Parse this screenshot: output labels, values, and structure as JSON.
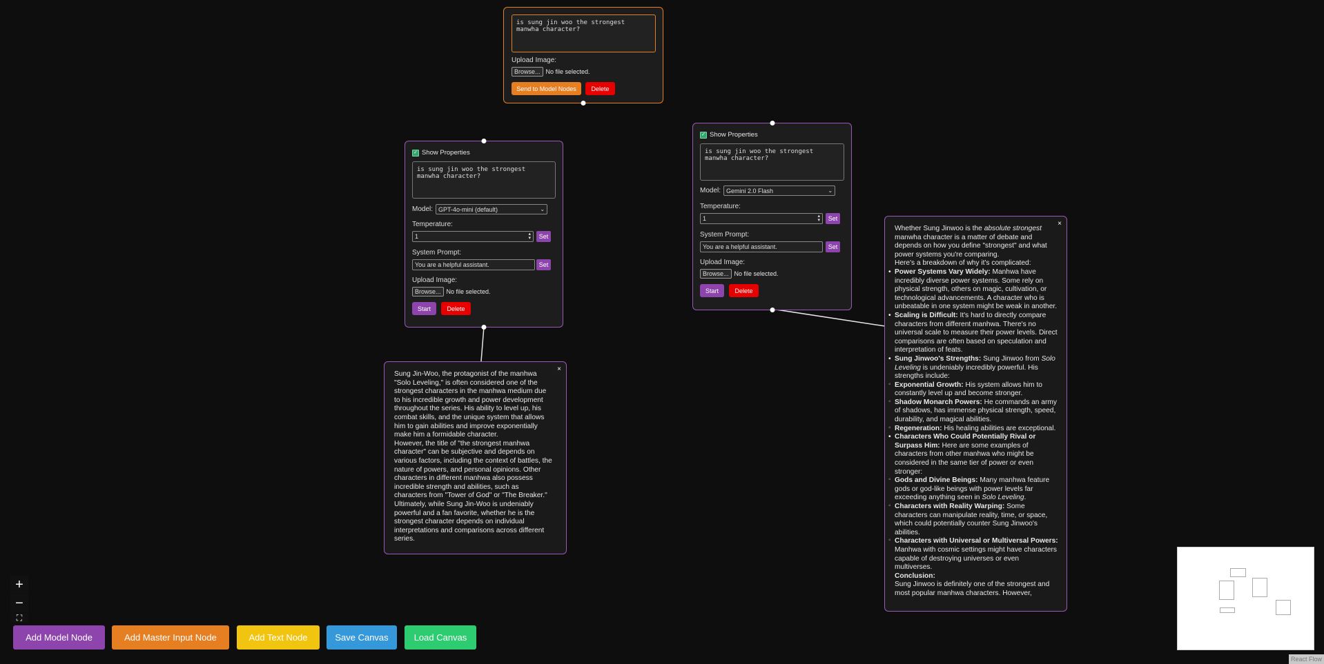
{
  "master_node": {
    "prompt": "is sung jin woo the strongest manwha character?",
    "upload_label": "Upload Image:",
    "browse_label": "Browse...",
    "file_status": "No file selected.",
    "send_label": "Send to Model Nodes",
    "delete_label": "Delete"
  },
  "model_nodes": [
    {
      "show_properties_label": "Show Properties",
      "show_properties_checked": true,
      "prompt": "is sung jin woo the strongest manwha character?",
      "model_label": "Model:",
      "model_value": "GPT-4o-mini (default)",
      "temperature_label": "Temperature:",
      "temperature_value": "1",
      "set_label": "Set",
      "system_prompt_label": "System Prompt:",
      "system_prompt_value": "You are a helpful assistant.",
      "upload_label": "Upload Image:",
      "browse_label": "Browse...",
      "file_status": "No file selected.",
      "start_label": "Start",
      "delete_label": "Delete"
    },
    {
      "show_properties_label": "Show Properties",
      "show_properties_checked": true,
      "prompt": "is sung jin woo the strongest manwha character?",
      "model_label": "Model:",
      "model_value": "Gemini 2.0 Flash",
      "temperature_label": "Temperature:",
      "temperature_value": "1",
      "set_label": "Set",
      "system_prompt_label": "System Prompt:",
      "system_prompt_value": "You are a helpful assistant.",
      "upload_label": "Upload Image:",
      "browse_label": "Browse...",
      "file_status": "No file selected.",
      "start_label": "Start",
      "delete_label": "Delete"
    }
  ],
  "output_gpt": {
    "close": "×",
    "p1": "Sung Jin-Woo, the protagonist of the manhwa \"Solo Leveling,\" is often considered one of the strongest characters in the manhwa medium due to his incredible growth and power development throughout the series. His ability to level up, his combat skills, and the unique system that allows him to gain abilities and improve exponentially make him a formidable character.",
    "p2": "However, the title of \"the strongest manhwa character\" can be subjective and depends on various factors, including the context of battles, the nature of powers, and personal opinions. Other characters in different manhwa also possess incredible strength and abilities, such as characters from \"Tower of God\" or \"The Breaker.\" Ultimately, while Sung Jin-Woo is undeniably powerful and a fan favorite, whether he is the strongest character depends on individual interpretations and comparisons across different series."
  },
  "output_gemini": {
    "close": "×",
    "intro_a": "Whether Sung Jinwoo is the ",
    "intro_em": "absolute strongest",
    "intro_b": " manwha character is a matter of debate and depends on how you define \"strongest\" and what power systems you're comparing.",
    "breakdown": "Here's a breakdown of why it's complicated:",
    "b1_title": "Power Systems Vary Widely:",
    "b1_text": " Manhwa have incredibly diverse power systems. Some rely on physical strength, others on magic, cultivation, or technological advancements. A character who is unbeatable in one system might be weak in another.",
    "b2_title": "Scaling is Difficult:",
    "b2_text": " It's hard to directly compare characters from different manhwa. There's no universal scale to measure their power levels. Direct comparisons are often based on speculation and interpretation of feats.",
    "b3_title": "Sung Jinwoo's Strengths:",
    "b3_text_a": " Sung Jinwoo from ",
    "b3_em": "Solo Leveling",
    "b3_text_b": " is undeniably incredibly powerful. His strengths include:",
    "s1_title": "Exponential Growth:",
    "s1_text": " His system allows him to constantly level up and become stronger.",
    "s2_title": "Shadow Monarch Powers:",
    "s2_text": " He commands an army of shadows, has immense physical strength, speed, durability, and magical abilities.",
    "s3_title": "Regeneration:",
    "s3_text": " His healing abilities are exceptional.",
    "b4_title": "Characters Who Could Potentially Rival or Surpass Him:",
    "b4_text": " Here are some examples of characters from other manhwa who might be considered in the same tier of power or even stronger:",
    "r1_title": "Gods and Divine Beings:",
    "r1_text_a": " Many manhwa feature gods or god-like beings with power levels far exceeding anything seen in ",
    "r1_em": "Solo Leveling",
    "r1_text_b": ".",
    "r2_title": "Characters with Reality Warping:",
    "r2_text": " Some characters can manipulate reality, time, or space, which could potentially counter Sung Jinwoo's abilities.",
    "r3_title": "Characters with Universal or Multiversal Powers:",
    "r3_text": " Manhwa with cosmic settings might have characters capable of destroying universes or even multiverses.",
    "conclusion_title": "Conclusion:",
    "conclusion_text": "Sung Jinwoo is definitely one of the strongest and most popular manhwa characters. However,"
  },
  "controls": {
    "zoom_in": "+",
    "zoom_out": "−",
    "fit_view": "⛶"
  },
  "toolbar": {
    "add_model": "Add Model Node",
    "add_master": "Add Master Input Node",
    "add_text": "Add Text Node",
    "save": "Save Canvas",
    "load": "Load Canvas"
  },
  "colors": {
    "model_node_border": "#9b59b6",
    "master_node_border": "#e67e22",
    "add_model_bg": "#8e44ad",
    "add_master_bg": "#e67e22",
    "add_text_bg": "#f1c40f",
    "save_bg": "#3498db",
    "load_bg": "#2ecc71",
    "delete_bg": "#e60000"
  },
  "attribution": "React Flow"
}
